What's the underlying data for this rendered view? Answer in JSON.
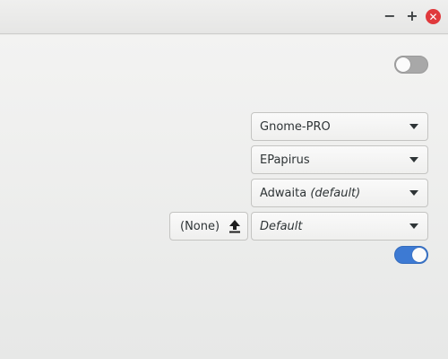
{
  "titlebar": {
    "minimize_label": "−",
    "maximize_label": "+",
    "close_label": "✕"
  },
  "settings": {
    "top_toggle": {
      "state": "off"
    },
    "theme_combo": {
      "value": "Gnome-PRO"
    },
    "icons_combo": {
      "value": "EPapirus"
    },
    "cursor_combo": {
      "value": "Adwaita",
      "suffix": "(default)"
    },
    "background_file": {
      "label": "(None)",
      "icon": "upload-icon"
    },
    "background_combo": {
      "value": "Default"
    },
    "bottom_toggle": {
      "state": "on"
    }
  },
  "colors": {
    "accent": "#3d7ad3",
    "close_button": "#e0393c"
  }
}
